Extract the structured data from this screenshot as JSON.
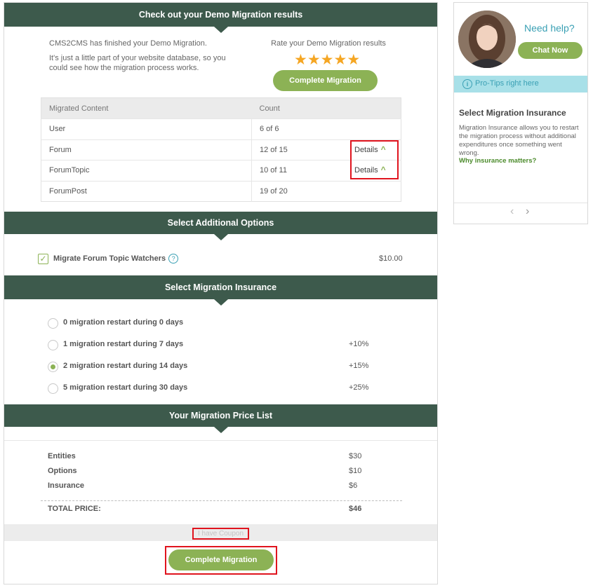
{
  "demo": {
    "band_title": "Check out your Demo Migration results",
    "finished_text": "CMS2CMS has finished your Demo Migration.",
    "part_text": "It's just a little part of your website database, so you could see how the migration process works.",
    "rate_label": "Rate your Demo Migration results",
    "stars": 5,
    "complete_button": "Complete Migration",
    "table": {
      "headers": [
        "Migrated Content",
        "Count"
      ],
      "rows": [
        {
          "content": "User",
          "count": "6 of 6",
          "details": ""
        },
        {
          "content": "Forum",
          "count": "12 of 15",
          "details": "Details"
        },
        {
          "content": "ForumTopic",
          "count": "10 of 11",
          "details": "Details"
        },
        {
          "content": "ForumPost",
          "count": "19 of 20",
          "details": ""
        }
      ]
    }
  },
  "options": {
    "band_title": "Select Additional Options",
    "item_label": "Migrate Forum Topic Watchers",
    "help_glyph": "?",
    "checked": true,
    "price": "$10.00"
  },
  "insurance": {
    "band_title": "Select Migration Insurance",
    "options": [
      {
        "label": "0 migration restart during 0 days",
        "pct": "",
        "selected": false
      },
      {
        "label": "1 migration restart during 7 days",
        "pct": "+10%",
        "selected": false
      },
      {
        "label": "2 migration restart during 14 days",
        "pct": "+15%",
        "selected": true
      },
      {
        "label": "5 migration restart during 30 days",
        "pct": "+25%",
        "selected": false
      }
    ]
  },
  "price_list": {
    "band_title": "Your Migration Price List",
    "entities_label": "Entities",
    "entities_value": "$30",
    "options_label": "Options",
    "options_value": "$10",
    "insurance_label": "Insurance",
    "insurance_value": "$6",
    "total_label": "TOTAL PRICE:",
    "total_value": "$46",
    "coupon_link": "I have Coupon",
    "complete_button": "Complete Migration"
  },
  "sidebar": {
    "need_help": "Need help?",
    "chat_button": "Chat Now",
    "pro_tips": "Pro-Tips right here",
    "tip_title": "Select Migration Insurance",
    "tip_body": "Migration Insurance allows you to restart the migration process without additional expenditures once something went wrong.",
    "tip_link": "Why insurance matters?"
  },
  "colors": {
    "band": "#3d5a4c",
    "accent_green": "#8cb255",
    "star": "#f5a623",
    "highlight_red": "#e0141e",
    "tips_bar": "#a8e0e8"
  }
}
